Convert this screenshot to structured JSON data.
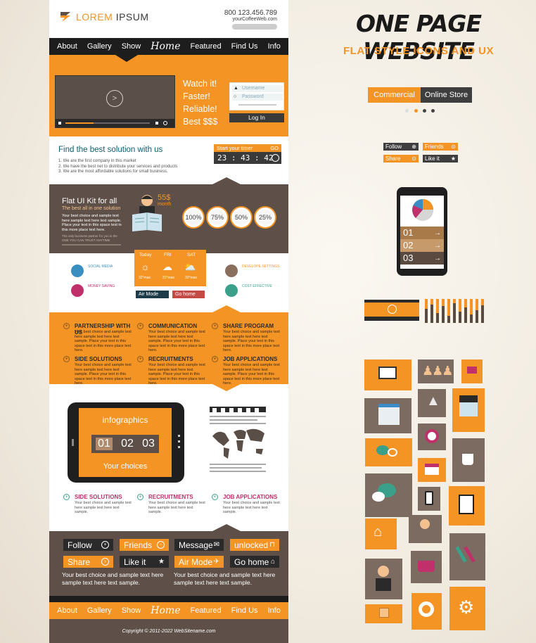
{
  "header": {
    "logo_left": "LOREM",
    "logo_right": "IPSUM",
    "phone": "800 123.456.789",
    "website": "yourCoffeeWeb.com"
  },
  "nav": {
    "items": [
      "About",
      "Gallery",
      "Show",
      "Home",
      "Featured",
      "Find Us",
      "Info"
    ]
  },
  "hero": {
    "taglines": [
      "Watch it!",
      "Faster!",
      "Reliable!",
      "Best $$$"
    ],
    "username_placeholder": "Username",
    "password_placeholder": "Password",
    "login_label": "Log In"
  },
  "solution": {
    "title": "Find the best solution with us",
    "items": [
      "1. We are the first company in this market",
      "2. We have the best net to distribute your services and products",
      "3. We are the most affordable solutions for small business."
    ],
    "timer_label": "Start your timer",
    "timer_go": "GO",
    "timer_value": "23 : 43 : 42"
  },
  "kit": {
    "title": "Flat UI Kit for all",
    "subtitle": "The best all in one solution",
    "text": "Your best choice and sample text here sample text here text sample. Place your text in this space text in this more place text here.",
    "small": "The only business partner for you is the ONE YOU CAN TRUST ANYTIME",
    "price": "55$",
    "price_unit": "month",
    "percents": [
      "100%",
      "75%",
      "50%",
      "25%"
    ]
  },
  "weather": {
    "days": [
      "Today",
      "FRI",
      "SAT"
    ],
    "temps": [
      "32°max",
      "31°max",
      "33°max"
    ],
    "left_items": [
      "SOCIAL MEDIA",
      "MONEY SAVING"
    ],
    "right_items": [
      "DEVELOPE SETTINGS",
      "COST EFFECTIVE"
    ],
    "air_mode": "Air Mode",
    "go_home": "Go home"
  },
  "services": {
    "items": [
      "PARTNERSHIP WITH US",
      "COMMUNICATION",
      "SHARE PROGRAM",
      "SIDE SOLUTIONS",
      "RECRUITMENTS",
      "JOB APPLICATIONS"
    ],
    "text": "Your best choice and sample text here sample text here text sample. Place your text in this space text in this more place text here."
  },
  "infographics": {
    "title": "infographics",
    "numbers": [
      "01",
      "02",
      "03"
    ],
    "subtitle": "Your choices",
    "items": [
      "SIDE SOLUTIONS",
      "RECRUITMENTS",
      "JOB APPLICATIONS"
    ],
    "text": "Your best choice and sample text here sample text here text sample."
  },
  "buttons": {
    "row1": [
      "Follow",
      "Friends",
      "Message",
      "unlocked"
    ],
    "row2": [
      "Share",
      "Like it",
      "Air Mode",
      "Go home"
    ],
    "sample": "Your best choice and sample text here sample text here text sample."
  },
  "footer": {
    "copyright": "Copyright © 2011-2022  WebSitename.com"
  },
  "right": {
    "title": "ONE PAGE WEBSITE",
    "subtitle": "FLAT STYLE ICONS AND UX",
    "toggle": [
      "Commercial",
      "Online Store"
    ],
    "mini_buttons": [
      "Follow",
      "Friends",
      "Share",
      "Like it"
    ],
    "phone_numbers": [
      "01",
      "02",
      "03"
    ]
  },
  "colors": {
    "accent": "#f39425",
    "brown": "#5e5048",
    "dark": "#1d1d1d",
    "gray_tile": "#7b6b60"
  }
}
